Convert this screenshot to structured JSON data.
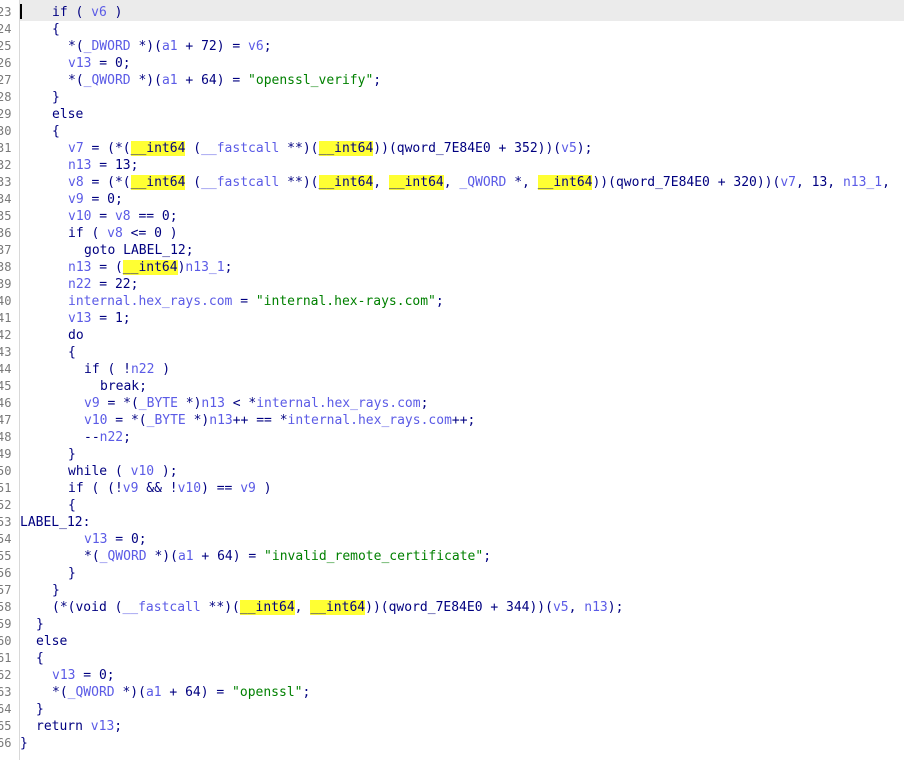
{
  "editor": {
    "caret_line": 23,
    "colors": {
      "plain": "#000080",
      "variable": "#5b5be6",
      "string": "#008000",
      "highlight_bg": "#ffff33",
      "gutter_text": "#7a7a7a",
      "current_line_bg": "#ebebeb"
    },
    "lines": [
      {
        "num": "23",
        "indent": 2,
        "tokens": [
          [
            "p",
            "if ( "
          ],
          [
            "v",
            "v6"
          ],
          [
            "p",
            " )"
          ]
        ]
      },
      {
        "num": "24",
        "indent": 2,
        "tokens": [
          [
            "p",
            "{"
          ]
        ]
      },
      {
        "num": "25",
        "indent": 3,
        "tokens": [
          [
            "p",
            "*("
          ],
          [
            "v",
            "_DWORD"
          ],
          [
            "p",
            " *)("
          ],
          [
            "v",
            "a1"
          ],
          [
            "p",
            " + 72) = "
          ],
          [
            "v",
            "v6"
          ],
          [
            "p",
            ";"
          ]
        ]
      },
      {
        "num": "26",
        "indent": 3,
        "tokens": [
          [
            "v",
            "v13"
          ],
          [
            "p",
            " = 0;"
          ]
        ]
      },
      {
        "num": "27",
        "indent": 3,
        "tokens": [
          [
            "p",
            "*("
          ],
          [
            "v",
            "_QWORD"
          ],
          [
            "p",
            " *)("
          ],
          [
            "v",
            "a1"
          ],
          [
            "p",
            " + 64) = "
          ],
          [
            "s",
            "\"openssl_verify\""
          ],
          [
            "p",
            ";"
          ]
        ]
      },
      {
        "num": "28",
        "indent": 2,
        "tokens": [
          [
            "p",
            "}"
          ]
        ]
      },
      {
        "num": "29",
        "indent": 2,
        "tokens": [
          [
            "p",
            "else"
          ]
        ]
      },
      {
        "num": "30",
        "indent": 2,
        "tokens": [
          [
            "p",
            "{"
          ]
        ]
      },
      {
        "num": "31",
        "indent": 3,
        "tokens": [
          [
            "v",
            "v7"
          ],
          [
            "p",
            " = (*("
          ],
          [
            "h",
            "__int64"
          ],
          [
            "p",
            " ("
          ],
          [
            "v",
            "__fastcall"
          ],
          [
            "p",
            " **)("
          ],
          [
            "h",
            "__int64"
          ],
          [
            "p",
            "))(qword_7E84E0 + 352))("
          ],
          [
            "v",
            "v5"
          ],
          [
            "p",
            ");"
          ]
        ]
      },
      {
        "num": "32",
        "indent": 3,
        "tokens": [
          [
            "v",
            "n13"
          ],
          [
            "p",
            " = 13;"
          ]
        ]
      },
      {
        "num": "33",
        "indent": 3,
        "tokens": [
          [
            "v",
            "v8"
          ],
          [
            "p",
            " = (*("
          ],
          [
            "h",
            "__int64"
          ],
          [
            "p",
            " ("
          ],
          [
            "v",
            "__fastcall"
          ],
          [
            "p",
            " **)("
          ],
          [
            "h",
            "__int64"
          ],
          [
            "p",
            ", "
          ],
          [
            "h",
            "__int64"
          ],
          [
            "p",
            ", "
          ],
          [
            "v",
            "_QWORD"
          ],
          [
            "p",
            " *, "
          ],
          [
            "h",
            "__int64"
          ],
          [
            "p",
            "))(qword_7E84E0 + 320))("
          ],
          [
            "v",
            "v7"
          ],
          [
            "p",
            ", 13, "
          ],
          [
            "v",
            "n13_1"
          ],
          [
            "p",
            ","
          ]
        ]
      },
      {
        "num": "34",
        "indent": 3,
        "tokens": [
          [
            "v",
            "v9"
          ],
          [
            "p",
            " = 0;"
          ]
        ]
      },
      {
        "num": "35",
        "indent": 3,
        "tokens": [
          [
            "v",
            "v10"
          ],
          [
            "p",
            " = "
          ],
          [
            "v",
            "v8"
          ],
          [
            "p",
            " == 0;"
          ]
        ]
      },
      {
        "num": "36",
        "indent": 3,
        "tokens": [
          [
            "p",
            "if ( "
          ],
          [
            "v",
            "v8"
          ],
          [
            "p",
            " <= 0 )"
          ]
        ]
      },
      {
        "num": "37",
        "indent": 4,
        "tokens": [
          [
            "p",
            "goto LABEL_12;"
          ]
        ]
      },
      {
        "num": "38",
        "indent": 3,
        "tokens": [
          [
            "v",
            "n13"
          ],
          [
            "p",
            " = ("
          ],
          [
            "h",
            "__int64"
          ],
          [
            "p",
            ")"
          ],
          [
            "v",
            "n13_1"
          ],
          [
            "p",
            ";"
          ]
        ]
      },
      {
        "num": "39",
        "indent": 3,
        "tokens": [
          [
            "v",
            "n22"
          ],
          [
            "p",
            " = 22;"
          ]
        ]
      },
      {
        "num": "40",
        "indent": 3,
        "tokens": [
          [
            "v",
            "internal.hex_rays.com"
          ],
          [
            "p",
            " = "
          ],
          [
            "s",
            "\"internal.hex-rays.com\""
          ],
          [
            "p",
            ";"
          ]
        ]
      },
      {
        "num": "41",
        "indent": 3,
        "tokens": [
          [
            "v",
            "v13"
          ],
          [
            "p",
            " = 1;"
          ]
        ]
      },
      {
        "num": "42",
        "indent": 3,
        "tokens": [
          [
            "p",
            "do"
          ]
        ]
      },
      {
        "num": "43",
        "indent": 3,
        "tokens": [
          [
            "p",
            "{"
          ]
        ]
      },
      {
        "num": "44",
        "indent": 4,
        "tokens": [
          [
            "p",
            "if ( !"
          ],
          [
            "v",
            "n22"
          ],
          [
            "p",
            " )"
          ]
        ]
      },
      {
        "num": "45",
        "indent": 5,
        "tokens": [
          [
            "p",
            "break;"
          ]
        ]
      },
      {
        "num": "46",
        "indent": 4,
        "tokens": [
          [
            "v",
            "v9"
          ],
          [
            "p",
            " = *("
          ],
          [
            "v",
            "_BYTE"
          ],
          [
            "p",
            " *)"
          ],
          [
            "v",
            "n13"
          ],
          [
            "p",
            " < *"
          ],
          [
            "v",
            "internal.hex_rays.com"
          ],
          [
            "p",
            ";"
          ]
        ]
      },
      {
        "num": "47",
        "indent": 4,
        "tokens": [
          [
            "v",
            "v10"
          ],
          [
            "p",
            " = *("
          ],
          [
            "v",
            "_BYTE"
          ],
          [
            "p",
            " *)"
          ],
          [
            "v",
            "n13"
          ],
          [
            "p",
            "++ == *"
          ],
          [
            "v",
            "internal.hex_rays.com"
          ],
          [
            "p",
            "++;"
          ]
        ]
      },
      {
        "num": "48",
        "indent": 4,
        "tokens": [
          [
            "p",
            "--"
          ],
          [
            "v",
            "n22"
          ],
          [
            "p",
            ";"
          ]
        ]
      },
      {
        "num": "49",
        "indent": 3,
        "tokens": [
          [
            "p",
            "}"
          ]
        ]
      },
      {
        "num": "50",
        "indent": 3,
        "tokens": [
          [
            "p",
            "while ( "
          ],
          [
            "v",
            "v10"
          ],
          [
            "p",
            " );"
          ]
        ]
      },
      {
        "num": "51",
        "indent": 3,
        "tokens": [
          [
            "p",
            "if ( (!"
          ],
          [
            "v",
            "v9"
          ],
          [
            "p",
            " && !"
          ],
          [
            "v",
            "v10"
          ],
          [
            "p",
            ") == "
          ],
          [
            "v",
            "v9"
          ],
          [
            "p",
            " )"
          ]
        ]
      },
      {
        "num": "52",
        "indent": 3,
        "tokens": [
          [
            "p",
            "{"
          ]
        ]
      },
      {
        "num": "53",
        "indent": 0,
        "tokens": [
          [
            "p",
            "LABEL_12:"
          ]
        ]
      },
      {
        "num": "54",
        "indent": 4,
        "tokens": [
          [
            "v",
            "v13"
          ],
          [
            "p",
            " = 0;"
          ]
        ]
      },
      {
        "num": "55",
        "indent": 4,
        "tokens": [
          [
            "p",
            "*("
          ],
          [
            "v",
            "_QWORD"
          ],
          [
            "p",
            " *)("
          ],
          [
            "v",
            "a1"
          ],
          [
            "p",
            " + 64) = "
          ],
          [
            "s",
            "\"invalid_remote_certificate\""
          ],
          [
            "p",
            ";"
          ]
        ]
      },
      {
        "num": "56",
        "indent": 3,
        "tokens": [
          [
            "p",
            "}"
          ]
        ]
      },
      {
        "num": "57",
        "indent": 2,
        "tokens": [
          [
            "p",
            "}"
          ]
        ]
      },
      {
        "num": "58",
        "indent": 2,
        "tokens": [
          [
            "p",
            "(*(void ("
          ],
          [
            "v",
            "__fastcall"
          ],
          [
            "p",
            " **)("
          ],
          [
            "h",
            "__int64"
          ],
          [
            "p",
            ", "
          ],
          [
            "h",
            "__int64"
          ],
          [
            "p",
            "))(qword_7E84E0 + 344))("
          ],
          [
            "v",
            "v5"
          ],
          [
            "p",
            ", "
          ],
          [
            "v",
            "n13"
          ],
          [
            "p",
            ");"
          ]
        ]
      },
      {
        "num": "59",
        "indent": 1,
        "tokens": [
          [
            "p",
            "}"
          ]
        ]
      },
      {
        "num": "60",
        "indent": 1,
        "tokens": [
          [
            "p",
            "else"
          ]
        ]
      },
      {
        "num": "61",
        "indent": 1,
        "tokens": [
          [
            "p",
            "{"
          ]
        ]
      },
      {
        "num": "62",
        "indent": 2,
        "tokens": [
          [
            "v",
            "v13"
          ],
          [
            "p",
            " = 0;"
          ]
        ]
      },
      {
        "num": "63",
        "indent": 2,
        "tokens": [
          [
            "p",
            "*("
          ],
          [
            "v",
            "_QWORD"
          ],
          [
            "p",
            " *)("
          ],
          [
            "v",
            "a1"
          ],
          [
            "p",
            " + 64) = "
          ],
          [
            "s",
            "\"openssl\""
          ],
          [
            "p",
            ";"
          ]
        ]
      },
      {
        "num": "64",
        "indent": 1,
        "tokens": [
          [
            "p",
            "}"
          ]
        ]
      },
      {
        "num": "65",
        "indent": 1,
        "tokens": [
          [
            "p",
            "return "
          ],
          [
            "v",
            "v13"
          ],
          [
            "p",
            ";"
          ]
        ]
      },
      {
        "num": "66",
        "indent": 0,
        "tokens": [
          [
            "p",
            "}"
          ]
        ]
      }
    ]
  }
}
